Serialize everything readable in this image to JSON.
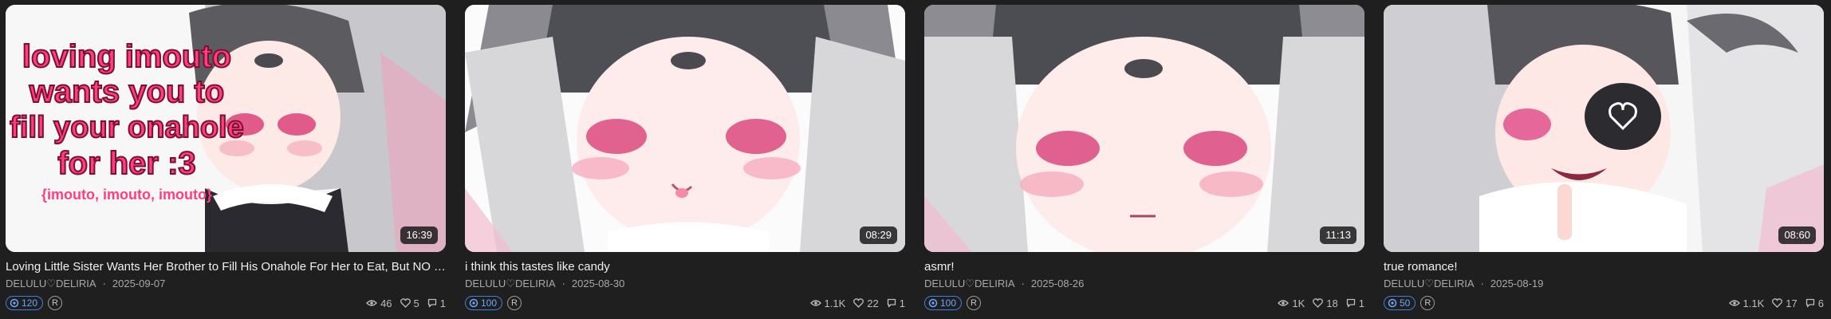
{
  "cards": [
    {
      "title": "Loving Little Sister Wants Her Brother to Fill His Onahole For Her to Eat, But NO Touchin...",
      "author": "DELULU♡DELIRIA",
      "date": "2025-09-07",
      "duration": "16:39",
      "score": "120",
      "rating": "R",
      "views": "46",
      "likes": "5",
      "comments": "1",
      "overlay_lines": [
        "loving imouto",
        "wants you to",
        "fill your onahole",
        "for her :3"
      ],
      "overlay_sub": "{imouto, imouto, imouto}"
    },
    {
      "title": "i think this tastes like candy",
      "author": "DELULU♡DELIRIA",
      "date": "2025-08-30",
      "duration": "08:29",
      "score": "100",
      "rating": "R",
      "views": "1.1K",
      "likes": "22",
      "comments": "1"
    },
    {
      "title": "asmr!",
      "author": "DELULU♡DELIRIA",
      "date": "2025-08-26",
      "duration": "11:13",
      "score": "100",
      "rating": "R",
      "views": "1K",
      "likes": "18",
      "comments": "1"
    },
    {
      "title": "true romance!",
      "author": "DELULU♡DELIRIA",
      "date": "2025-08-19",
      "duration": "08:60",
      "score": "50",
      "rating": "R",
      "views": "1.1K",
      "likes": "17",
      "comments": "6"
    }
  ],
  "icons": {
    "score": "score-icon",
    "views": "eye-icon",
    "likes": "heart-icon",
    "comments": "comment-icon"
  },
  "colors": {
    "background": "#1f1f1f",
    "score_accent": "#3d7fe0",
    "overlay_text": "#ff3d7f"
  }
}
